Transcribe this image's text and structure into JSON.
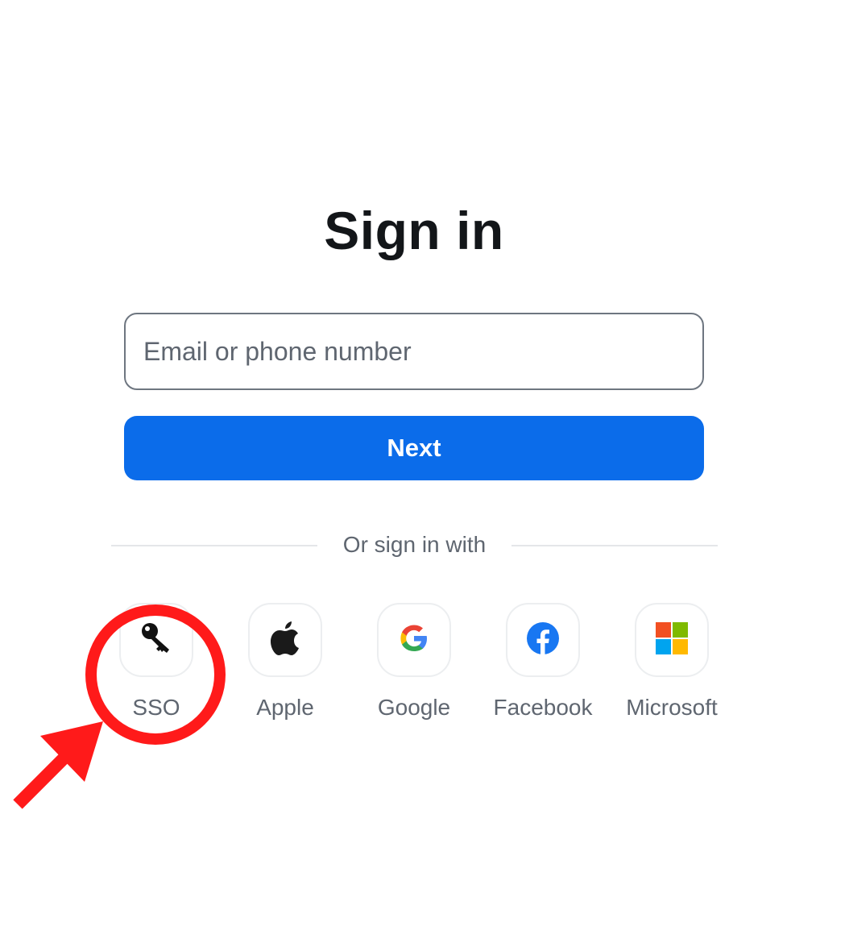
{
  "page": {
    "title": "Sign in"
  },
  "form": {
    "email_placeholder": "Email or phone number",
    "email_value": "",
    "next_label": "Next"
  },
  "divider": {
    "text": "Or sign in with"
  },
  "providers": [
    {
      "label": "SSO",
      "icon": "key-icon"
    },
    {
      "label": "Apple",
      "icon": "apple-icon"
    },
    {
      "label": "Google",
      "icon": "google-icon"
    },
    {
      "label": "Facebook",
      "icon": "facebook-icon"
    },
    {
      "label": "Microsoft",
      "icon": "microsoft-icon"
    }
  ],
  "colors": {
    "accent": "#0b6cea",
    "annotation": "#ff1a1a",
    "facebook": "#1877f2",
    "google_blue": "#4285f4",
    "google_red": "#ea4335",
    "google_yellow": "#fbbc05",
    "google_green": "#34a853",
    "microsoft_red": "#f25022",
    "microsoft_green": "#7fba00",
    "microsoft_blue": "#00a4ef",
    "microsoft_yellow": "#ffb900"
  },
  "annotation": {
    "type": "circle-with-arrow",
    "target": "SSO"
  }
}
